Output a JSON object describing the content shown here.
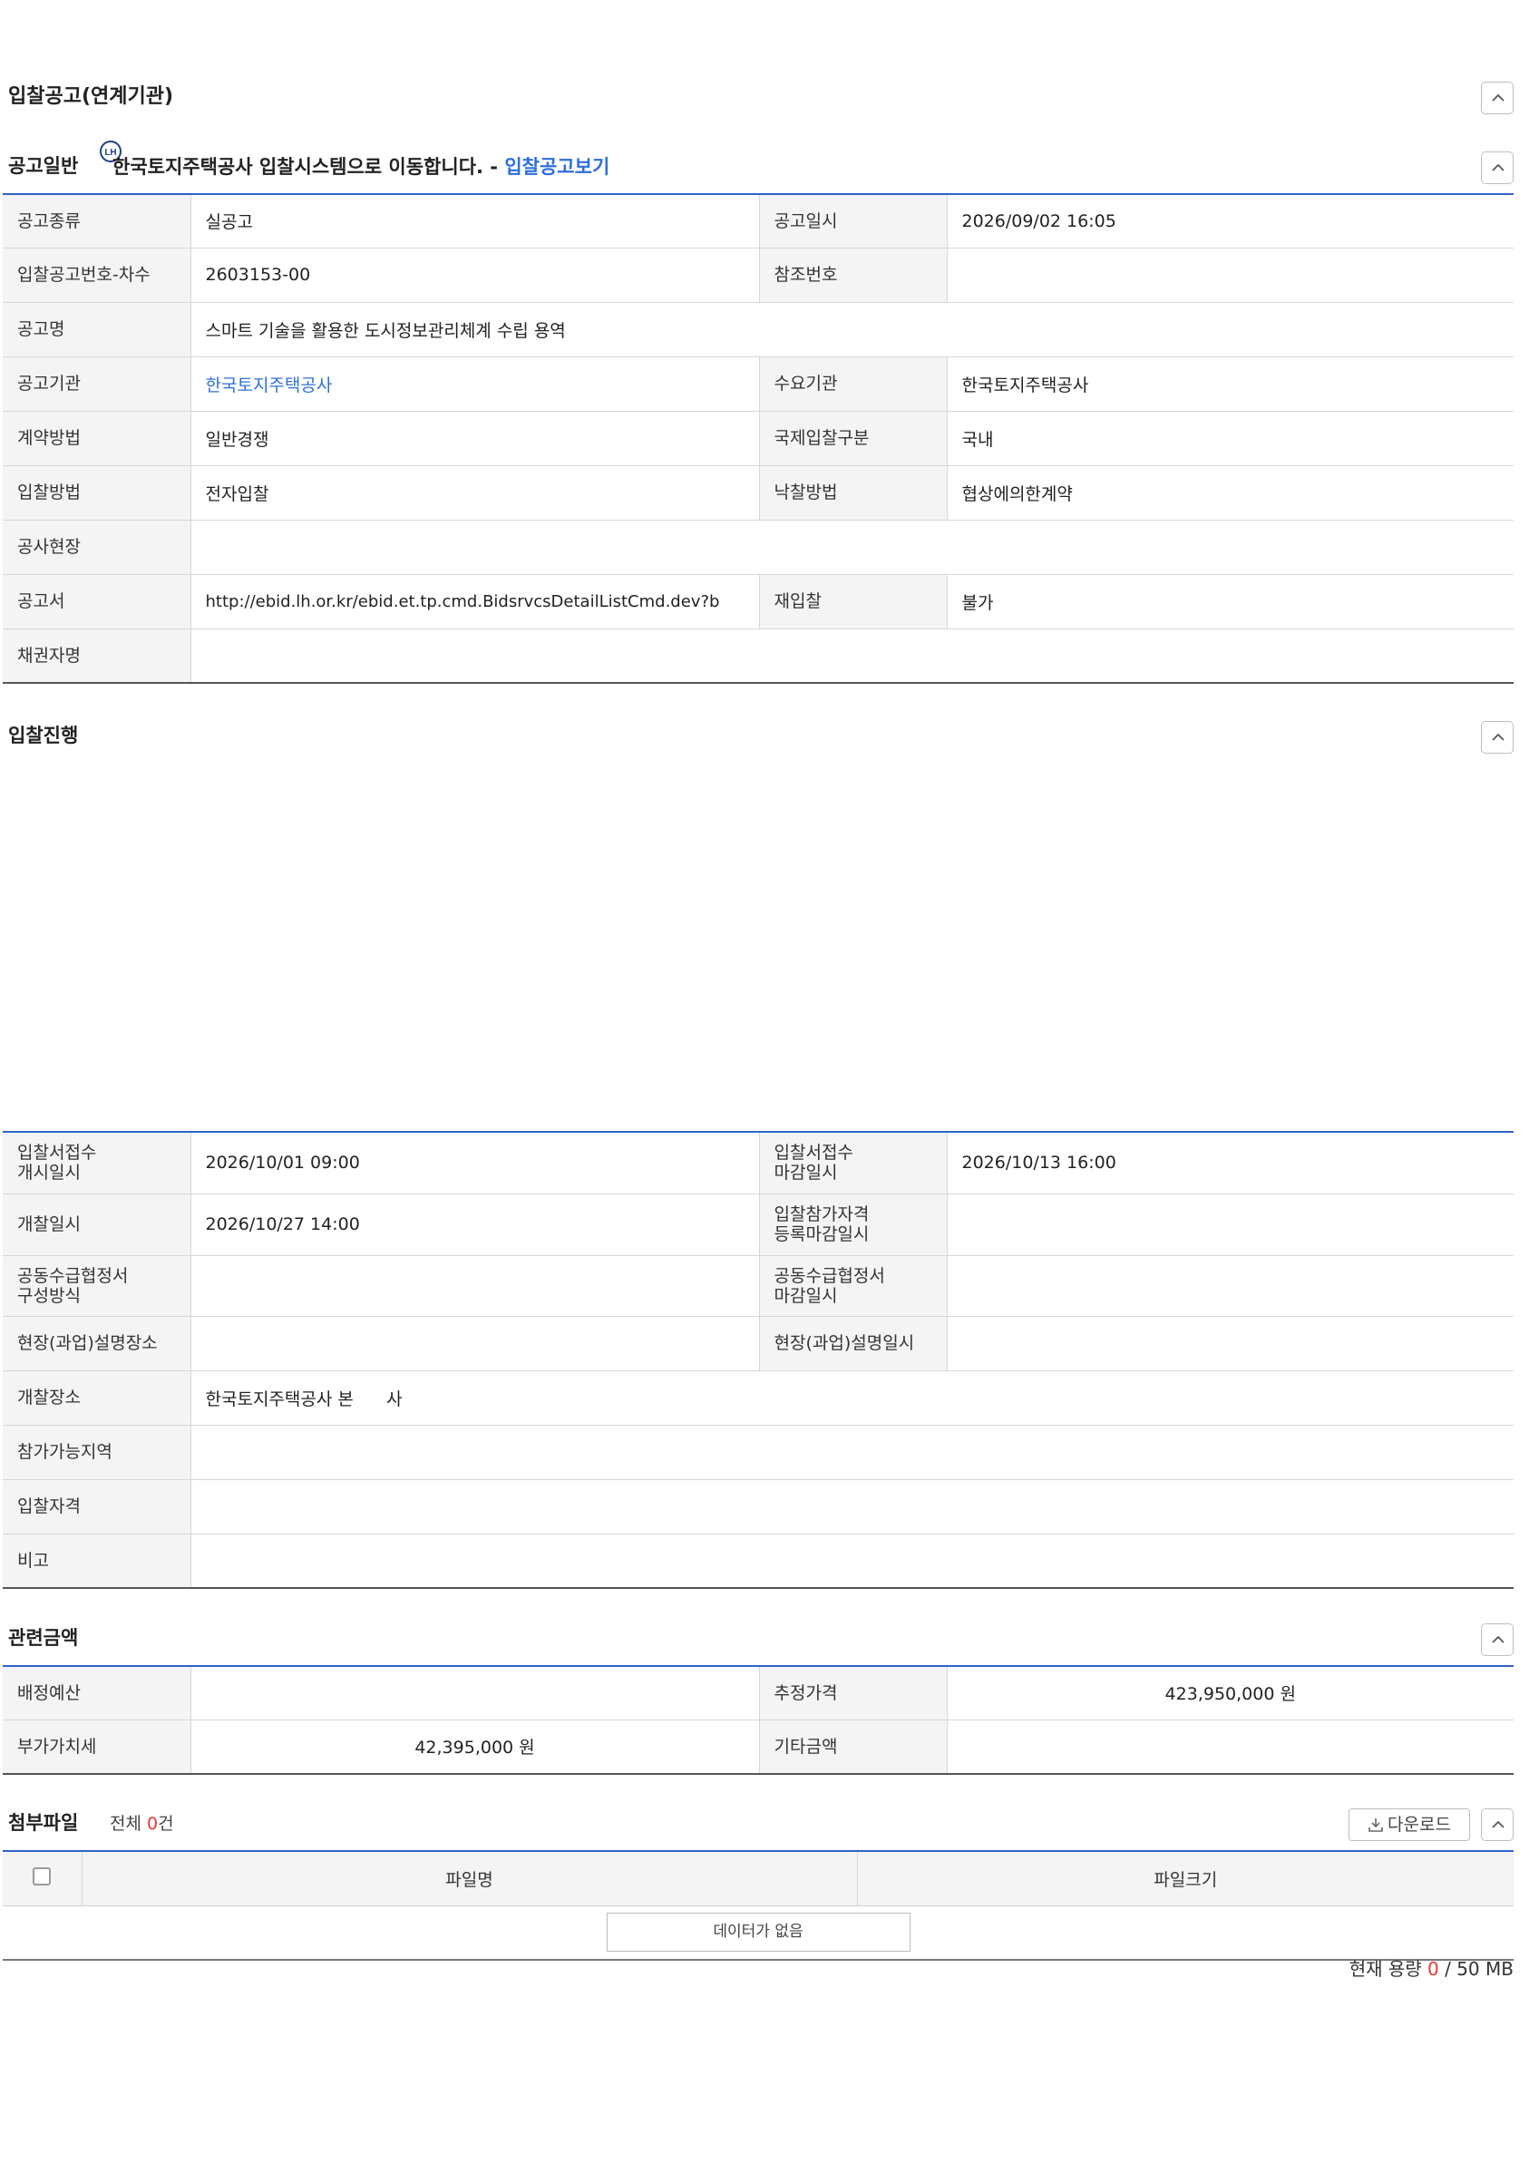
{
  "page": {
    "title": "입찰공고(연계기관)"
  },
  "general": {
    "title": "공고일반",
    "icon_label": "LH",
    "message": "한국토지주택공사 입찰시스템으로 이동합니다. - ",
    "link_text": "입찰공고보기",
    "rows": {
      "type_label": "공고종류",
      "type_value": "실공고",
      "date_label": "공고일시",
      "date_value": "2026/09/02 16:05",
      "no_label": "입찰공고번호-차수",
      "no_value": "2603153-00",
      "ref_label": "참조번호",
      "ref_value": "",
      "name_label": "공고명",
      "name_value": "스마트 기술을 활용한 도시정보관리체계 수립 용역",
      "agency_label": "공고기관",
      "agency_value": "한국토지주택공사",
      "demand_label": "수요기관",
      "demand_value": "한국토지주택공사",
      "contract_label": "계약방법",
      "contract_value": "일반경쟁",
      "intl_label": "국제입찰구분",
      "intl_value": "국내",
      "bidmethod_label": "입찰방법",
      "bidmethod_value": "전자입찰",
      "award_label": "낙찰방법",
      "award_value": "협상에의한계약",
      "site_label": "공사현장",
      "site_value": "",
      "doc_label": "공고서",
      "doc_value": "http://ebid.lh.or.kr/ebid.et.tp.cmd.BidsrvcsDetailListCmd.dev?b",
      "rebid_label": "재입찰",
      "rebid_value": "불가",
      "bond_label": "채권자명",
      "bond_value": ""
    }
  },
  "progress": {
    "title": "입찰진행",
    "rows": {
      "open_start_label": "입찰서접수\n개시일시",
      "open_start_value": "2026/10/01 09:00",
      "open_end_label": "입찰서접수\n마감일시",
      "open_end_value": "2026/10/13 16:00",
      "opening_label": "개찰일시",
      "opening_value": "2026/10/27 14:00",
      "qual_label": "입찰참가자격\n등록마감일시",
      "qual_value": "",
      "joint_label": "공동수급협정서\n구성방식",
      "joint_value": "",
      "joint_end_label": "공동수급협정서\n마감일시",
      "joint_end_value": "",
      "brief_place_label": "현장(과업)설명장소",
      "brief_place_value": "",
      "brief_date_label": "현장(과업)설명일시",
      "brief_date_value": "",
      "open_place_label": "개찰장소",
      "open_place_value": "한국토지주택공사 본      사",
      "region_label": "참가가능지역",
      "region_value": "",
      "qualification_label": "입찰자격",
      "qualification_value": "",
      "note_label": "비고",
      "note_value": ""
    }
  },
  "amounts": {
    "title": "관련금액",
    "budget_label": "배정예산",
    "budget_value": "",
    "estimate_label": "추정가격",
    "estimate_value": "423,950,000 원",
    "vat_label": "부가가치세",
    "vat_value": "42,395,000 원",
    "other_label": "기타금액",
    "other_value": ""
  },
  "files": {
    "title": "첨부파일",
    "count_prefix": "전체 ",
    "count": "0",
    "count_suffix": "건",
    "download_label": "다운로드",
    "col_name": "파일명",
    "col_size": "파일크기",
    "empty_text": "데이터가 없음",
    "capacity_label": "현재 용량 ",
    "capacity_used": "0",
    "capacity_total": " / 50 MB"
  },
  "colors": {
    "accent": "#2f63c6",
    "link": "#2e6fdc",
    "highlight": "#e53935"
  },
  "icons": [
    "chevron-up-icon",
    "lh-logo-icon",
    "download-icon",
    "checkbox"
  ]
}
